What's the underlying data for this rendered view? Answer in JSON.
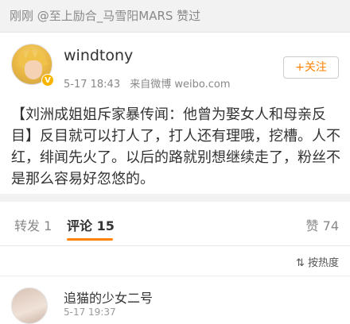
{
  "notice": "刚刚 @至上励合_马雪阳MARS 赞过",
  "post": {
    "username": "windtony",
    "time": "5-17 18:43",
    "source": "来自微博 weibo.com",
    "follow_label": "+关注",
    "text": "【刘洲成姐姐斥家暴传闻：他曾为娶女人和母亲反目】反目就可以打人了，打人还有理哦，挖槽。人不红，绯闻先火了。以后的路就别想继续走了，粉丝不是那么容易好忽悠的。",
    "verify_badge": "V"
  },
  "tabs": {
    "repost": "转发 1",
    "comment": "评论 15",
    "like": "赞 74"
  },
  "sort_label": "按热度",
  "comment": {
    "name": "追猫的少女二号",
    "time": "5-17 19:37"
  },
  "colors": {
    "accent": "#ff8200",
    "badge": "#f7b500"
  }
}
